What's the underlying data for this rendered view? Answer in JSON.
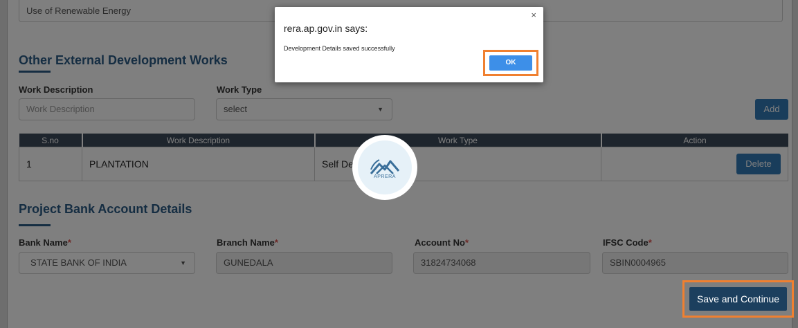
{
  "top_field": {
    "value": "Use of Renewable Energy"
  },
  "external_works": {
    "heading": "Other External Development Works",
    "work_description_label": "Work Description",
    "work_description_placeholder": "Work Description",
    "work_type_label": "Work Type",
    "work_type_selected": "select",
    "add_label": "Add",
    "table": {
      "headers": [
        "S.no",
        "Work Description",
        "Work Type",
        "Action"
      ],
      "rows": [
        {
          "sno": "1",
          "description": "PLANTATION",
          "type": "Self De",
          "action": "Delete"
        }
      ]
    }
  },
  "bank": {
    "heading": "Project Bank Account Details",
    "bank_name_label": "Bank Name",
    "bank_name_value": "STATE BANK OF INDIA",
    "branch_name_label": "Branch Name",
    "branch_name_value": "GUNEDALA",
    "account_no_label": "Account No",
    "account_no_value": "31824734068",
    "ifsc_label": "IFSC Code",
    "ifsc_value": "SBIN0004965",
    "required_mark": "*"
  },
  "save_continue_label": "Save and Continue",
  "loader": {
    "logo_text": "APRERA"
  },
  "dialog": {
    "title": "rera.ap.gov.in says:",
    "message": "Development Details saved successfully",
    "ok_label": "OK",
    "close_glyph": "×"
  },
  "colors": {
    "heading": "#2a5a85",
    "primary_button": "#337ab7",
    "highlight": "#f08030",
    "table_header": "#3c4a5a"
  }
}
